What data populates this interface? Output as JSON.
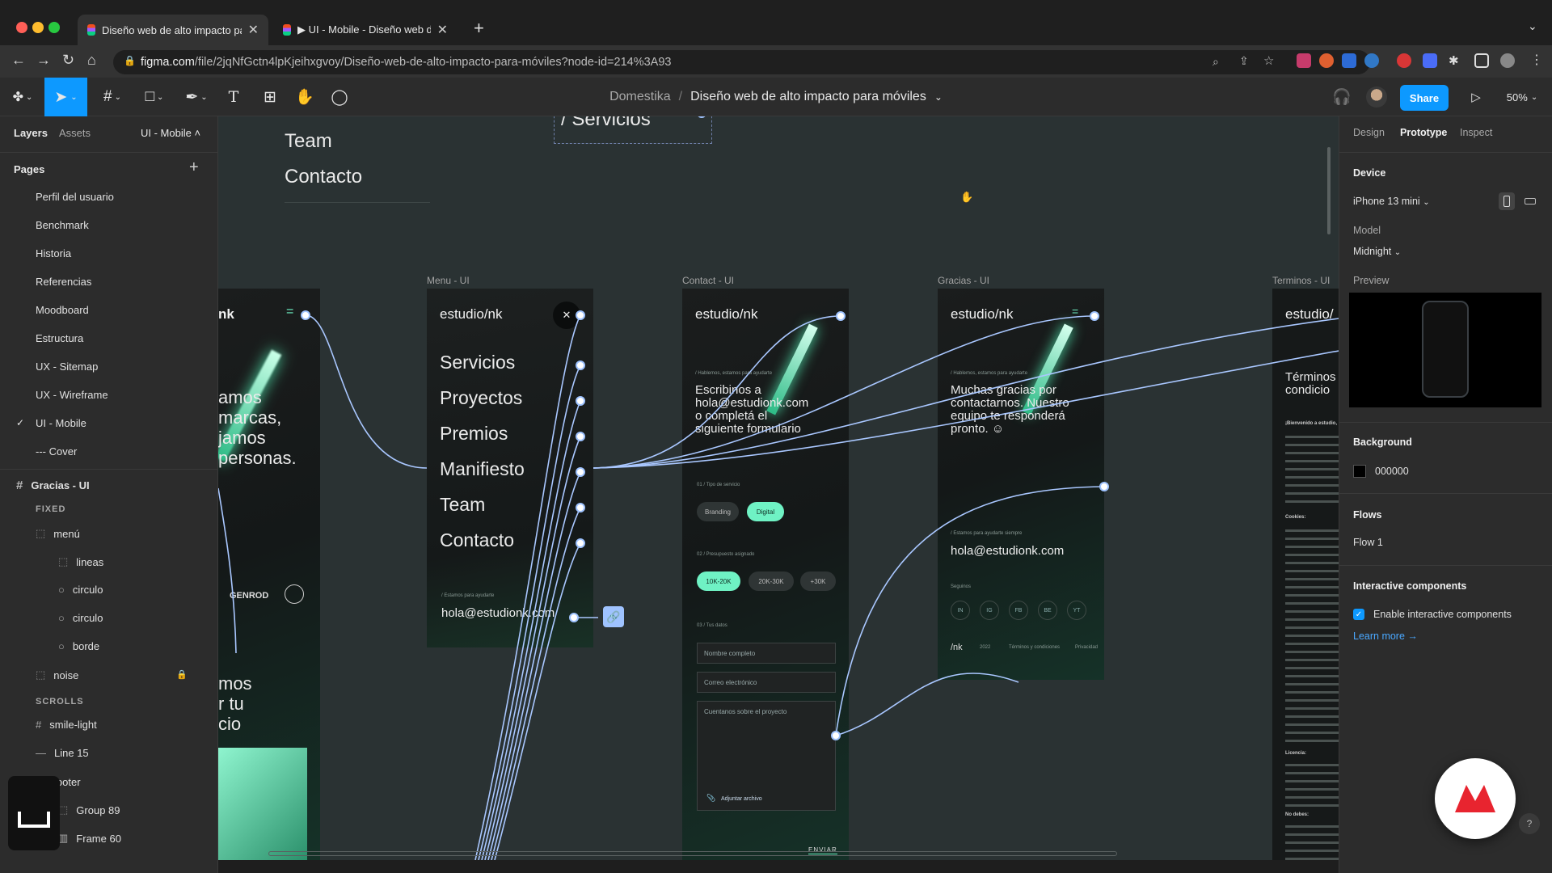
{
  "browser": {
    "tabs": [
      {
        "title": "Diseño web de alto impacto pa",
        "active": true
      },
      {
        "title": "▶ UI - Mobile - Diseño web de",
        "active": false
      }
    ],
    "new_tab_label": "+",
    "url_host": "figma.com",
    "url_path": "/file/2jqNfGctn4lpKjeihxgvoy/Diseño-web-de-alto-impacto-para-móviles?node-id=214%3A93"
  },
  "toolbar": {
    "breadcrumb_team": "Domestika",
    "breadcrumb_sep": "/",
    "file_title": "Diseño web de alto impacto para móviles",
    "share_label": "Share",
    "zoom": "50%"
  },
  "left_panel": {
    "tabs": [
      "Layers",
      "Assets"
    ],
    "page_switch": "UI - Mobile",
    "pages_label": "Pages",
    "pages": [
      "Perfil del usuario",
      "Benchmark",
      "Historia",
      "Referencias",
      "Moodboard",
      "Estructura",
      "UX - Sitemap",
      "UX - Wireframe",
      "UI - Mobile",
      "--- Cover"
    ],
    "current_page_index": 8,
    "frame_name": "Gracias - UI",
    "fixed_label": "FIXED",
    "scrolls_label": "SCROLLS",
    "layers": {
      "menu": "menú",
      "lineas": "lineas",
      "circulo1": "circulo",
      "circulo2": "circulo",
      "borde": "borde",
      "noise": "noise",
      "smile": "smile-light",
      "line15": "Line 15",
      "footer": "footer",
      "group89": "Group 89",
      "frame60": "Frame 60"
    }
  },
  "canvas": {
    "top_menu": {
      "team": "Team",
      "contacto": "Contacto",
      "servicios": "/ Servicios"
    },
    "frame_labels": [
      "Menu - UI",
      "Contact - UI",
      "Gracias - UI",
      "Terminos - UI"
    ],
    "partial_frame": {
      "logo": "nk",
      "lines": [
        "amos",
        "marcas,",
        "jamos",
        "personas."
      ],
      "brand1": "GENROD",
      "lines2": [
        "mos",
        "r tu",
        "cio"
      ]
    },
    "menu_frame": {
      "logo": "estudio/nk",
      "items": [
        "Servicios",
        "Proyectos",
        "Premios",
        "Manifiesto",
        "Team",
        "Contacto"
      ],
      "footer_small": "/ Estamos para ayudarte",
      "email": "hola@estudionk.com"
    },
    "contact_frame": {
      "logo": "estudio/nk",
      "kicker": "/ Hablemos, estamos para ayudarte",
      "headline": [
        "Escribinos a",
        "hola@estudionk.com",
        "o completá el",
        "siguiente formulario"
      ],
      "q1": "01 / Tipo de servicio",
      "pills1": [
        "Branding",
        "Digital"
      ],
      "q2": "02 / Presupuesto asignado",
      "pills2": [
        "10K-20K",
        "20K-30K",
        "+30K"
      ],
      "q3": "03 / Tus datos",
      "fields": [
        "Nombre completo",
        "Correo electrónico",
        "Cuentanos sobre el proyecto"
      ],
      "attach": "Adjuntar archivo",
      "send": "ENVIAR"
    },
    "gracias_frame": {
      "logo": "estudio/nk",
      "kicker": "/ Hablemos, estamos para ayudarte",
      "headline": [
        "Muchas gracias por",
        "contactarnos. Nuestro",
        "equipo te responderá",
        "pronto. ☺"
      ],
      "small": "/ Estamos para ayudarte siempre",
      "email": "hola@estudionk.com",
      "seguinos": "Seguinos",
      "socials": [
        "IN",
        "IG",
        "FB",
        "BE",
        "YT"
      ],
      "footer_logo": "/nk",
      "footer_year": "2022",
      "footer_links": [
        "Términos y condiciones",
        "Privacidad"
      ]
    },
    "terminos_frame": {
      "logo": "estudio/",
      "headline": [
        "Términos",
        "condicio"
      ],
      "welcome": "¡Bienvenido a estudio,",
      "cookies": "Cookies:",
      "licencia": "Licencia:",
      "nodebes": "No debes:"
    }
  },
  "right_panel": {
    "tabs": [
      "Design",
      "Prototype",
      "Inspect"
    ],
    "active_tab": "Prototype",
    "device_label": "Device",
    "device": "iPhone 13 mini",
    "model_label": "Model",
    "model": "Midnight",
    "preview_label": "Preview",
    "background_label": "Background",
    "background_value": "000000",
    "flows_label": "Flows",
    "flow": "Flow 1",
    "interactive_label": "Interactive components",
    "enable_label": "Enable interactive components",
    "enabled": true,
    "learn_more": "Learn more →"
  },
  "colors": {
    "accent": "#0d99ff",
    "mint": "#6ff2c4",
    "connector": "#a9c7ff"
  }
}
